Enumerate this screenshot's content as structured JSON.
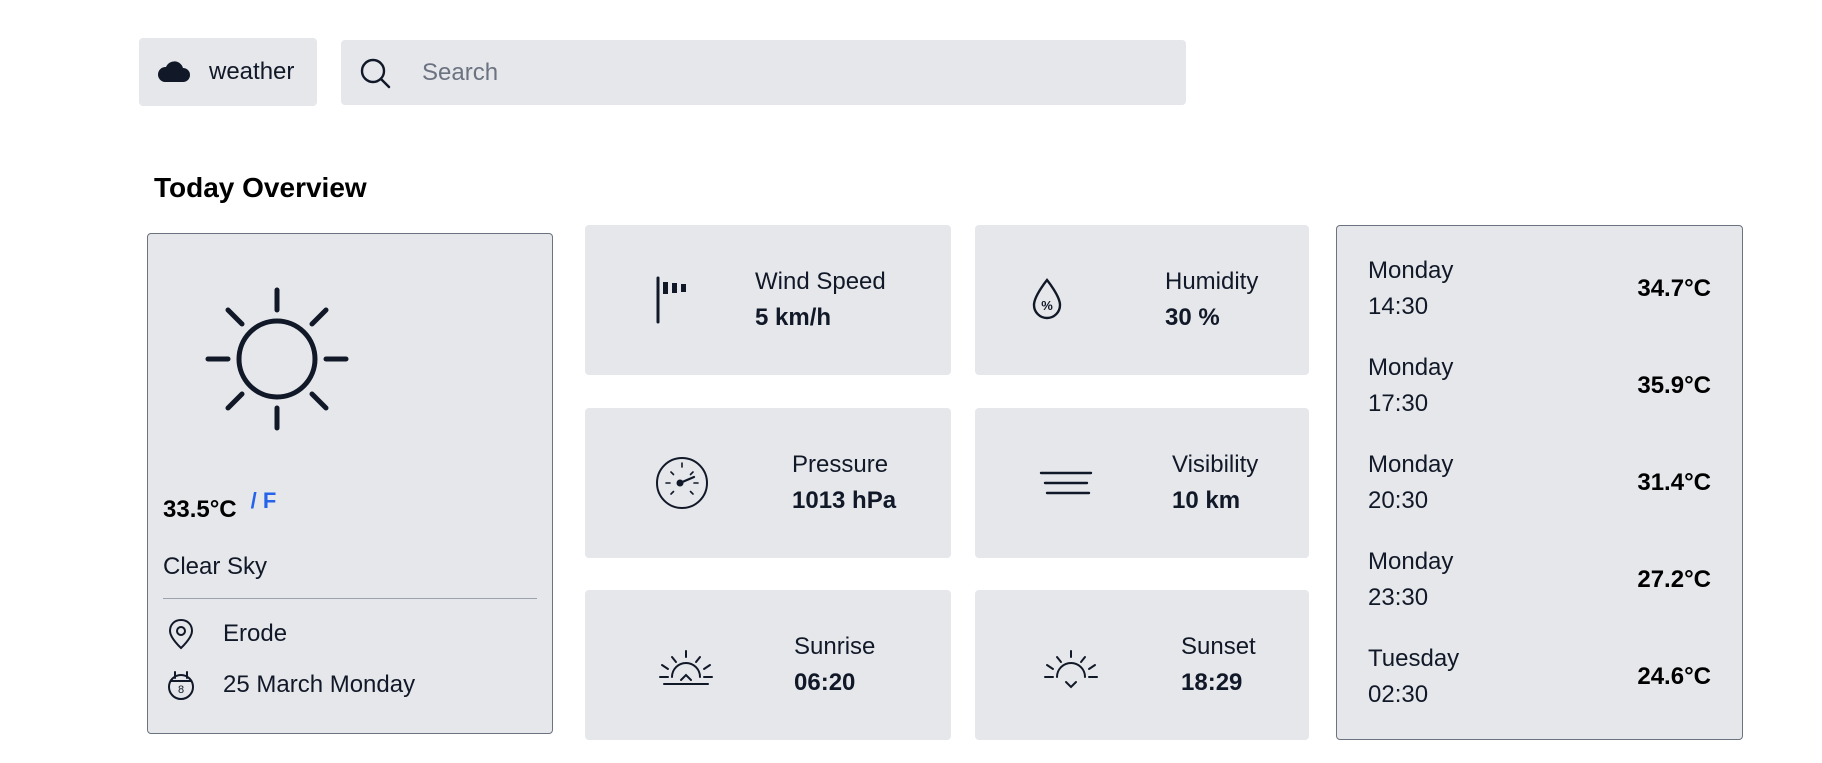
{
  "header": {
    "brand_label": "weather",
    "search_placeholder": "Search"
  },
  "overview": {
    "title": "Today Overview",
    "current": {
      "temperature": "33.5°C",
      "unit_toggle": "/ F",
      "condition": "Clear Sky",
      "location": "Erode",
      "date": "25 March Monday",
      "calendar_day": "8"
    },
    "stats": {
      "wind": {
        "label": "Wind Speed",
        "value": "5 km/h"
      },
      "humidity": {
        "label": "Humidity",
        "value": "30 %"
      },
      "pressure": {
        "label": "Pressure",
        "value": "1013 hPa"
      },
      "visibility": {
        "label": "Visibility",
        "value": "10 km"
      },
      "sunrise": {
        "label": "Sunrise",
        "value": "06:20"
      },
      "sunset": {
        "label": "Sunset",
        "value": "18:29"
      }
    },
    "forecast": [
      {
        "day": "Monday",
        "time": "14:30",
        "temp": "34.7°C"
      },
      {
        "day": "Monday",
        "time": "17:30",
        "temp": "35.9°C"
      },
      {
        "day": "Monday",
        "time": "20:30",
        "temp": "31.4°C"
      },
      {
        "day": "Monday",
        "time": "23:30",
        "temp": "27.2°C"
      },
      {
        "day": "Tuesday",
        "time": "02:30",
        "temp": "24.6°C"
      }
    ]
  },
  "icons": {
    "brand": "cloud-icon",
    "search": "search-icon",
    "weather": "sun-icon",
    "location": "location-pin-icon",
    "date": "calendar-icon",
    "wind": "windsock-icon",
    "humidity": "droplet-percent-icon",
    "pressure": "gauge-icon",
    "visibility": "fog-lines-icon",
    "sunrise": "sunrise-icon",
    "sunset": "sunset-icon"
  },
  "colors": {
    "card_background": "#e5e7eb",
    "accent": "#2563eb",
    "text": "#111827"
  }
}
